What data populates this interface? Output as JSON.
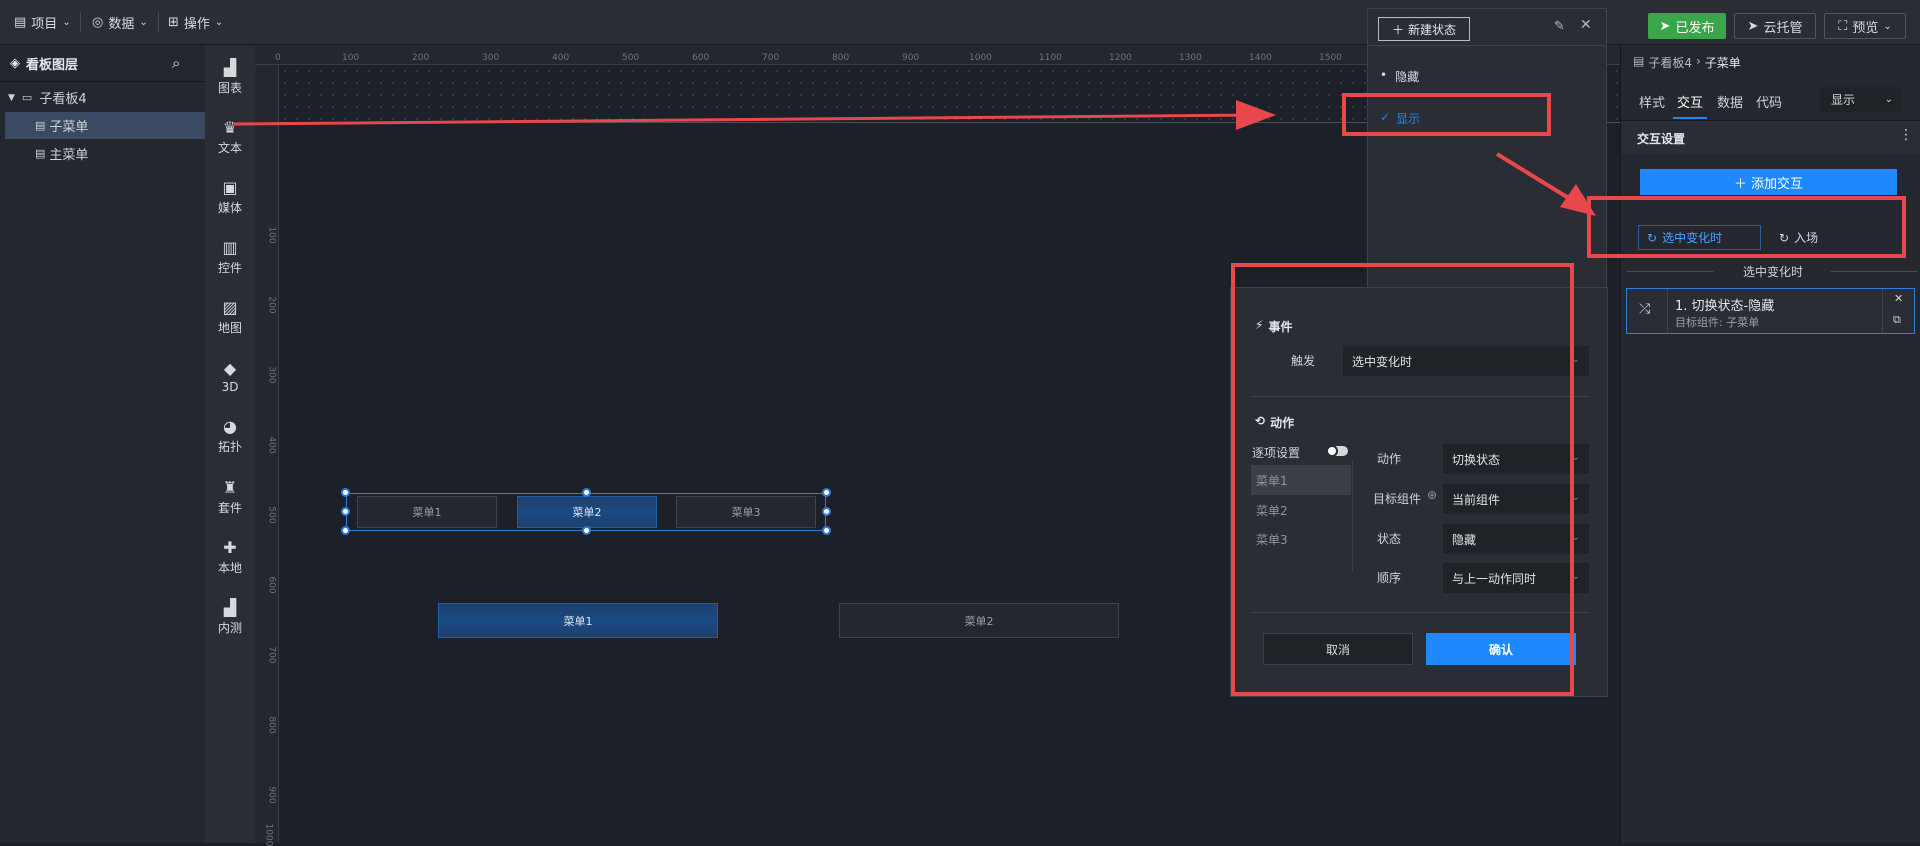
{
  "topbar": {
    "menu_project": "项目",
    "menu_data": "数据",
    "menu_operate": "操作",
    "publish_btn": "已发布",
    "cloud_btn": "云托管",
    "preview_btn": "预览"
  },
  "layers": {
    "title": "看板图层",
    "board": "子看板4",
    "items": [
      "子菜单",
      "主菜单"
    ]
  },
  "iconbar": {
    "items": [
      "图表",
      "文本",
      "媒体",
      "控件",
      "地图",
      "3D",
      "拓扑",
      "套件",
      "本地",
      "内测"
    ]
  },
  "ruler": {
    "top_ticks": [
      "0",
      "100",
      "200",
      "300",
      "400",
      "500",
      "600",
      "700",
      "800",
      "900",
      "1000",
      "1100",
      "1200",
      "1300",
      "1400",
      "1500"
    ],
    "left_ticks": [
      "100",
      "200",
      "300",
      "400",
      "500",
      "600",
      "700",
      "800",
      "900",
      "1000"
    ]
  },
  "canvas": {
    "tabs_top": [
      "菜单1",
      "菜单2",
      "菜单3"
    ],
    "tabs_bottom": [
      "菜单1",
      "菜单2"
    ]
  },
  "state_popup": {
    "new_state_btn": "新建状态",
    "states": [
      "隐藏",
      "显示"
    ]
  },
  "dialog": {
    "event_title": "事件",
    "trigger_label": "触发",
    "trigger_value": "选中变化时",
    "action_title": "动作",
    "per_item_label": "逐项设置",
    "menu_items": [
      "菜单1",
      "菜单2",
      "菜单3"
    ],
    "action_label": "动作",
    "action_value": "切换状态",
    "target_label": "目标组件",
    "target_value": "当前组件",
    "state_label": "状态",
    "state_value": "隐藏",
    "order_label": "顺序",
    "order_value": "与上一动作同时",
    "cancel_btn": "取消",
    "confirm_btn": "确认"
  },
  "right": {
    "breadcrumb_parent": "子看板4",
    "breadcrumb_current": "子菜单",
    "tabs": [
      "样式",
      "交互",
      "数据",
      "代码"
    ],
    "display_select": "显示",
    "section_title": "交互设置",
    "add_btn": "添加交互",
    "event_tabs": [
      "选中变化时",
      "入场"
    ],
    "group_title": "选中变化时",
    "card_title": "1. 切换状态-隐藏",
    "card_sub": "目标组件: 子菜单"
  },
  "colors": {
    "accent_blue": "#1e88ff",
    "annotation_red": "#e8484b",
    "publish_green": "#3aa64a"
  }
}
